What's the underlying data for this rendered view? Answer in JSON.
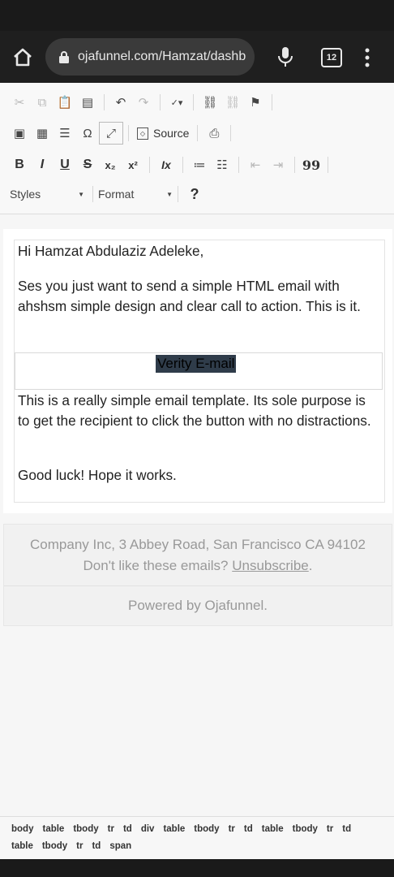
{
  "browser": {
    "url": "ojafunnel.com/Hamzat/dashb",
    "tab_count": "12"
  },
  "toolbar": {
    "source_label": "Source",
    "bold_label": "B",
    "italic_label": "I",
    "underline_label": "U",
    "strike_label": "S",
    "subscript_label": "x₂",
    "superscript_label": "x²",
    "remove_format_label": "Ix",
    "blockquote_label": "99",
    "styles_label": "Styles",
    "format_label": "Format",
    "help_label": "?"
  },
  "email": {
    "greeting": "Hi Hamzat Abdulaziz Adeleke,",
    "para1": "Ses you just want to send a simple HTML email with ahshsm simple design and clear call to action. This is it.",
    "button_label": "Verity E-mail",
    "para2": "This is a really simple email template. Its sole purpose is to get the recipient to click the button with no distractions.",
    "para3": "Good luck! Hope it works."
  },
  "footer": {
    "address": "Company Inc, 3 Abbey Road, San Francisco CA 94102",
    "unsub_prefix": "Don't like these emails? ",
    "unsub_link": "Unsubscribe",
    "unsub_suffix": ".",
    "powered": "Powered by Ojafunnel."
  },
  "elementspath": {
    "row1": [
      "body",
      "table",
      "tbody",
      "tr",
      "td",
      "div",
      "table",
      "tbody",
      "tr",
      "td",
      "table",
      "tbody",
      "tr",
      "td"
    ],
    "row2": [
      "table",
      "tbody",
      "tr",
      "td",
      "span"
    ]
  }
}
